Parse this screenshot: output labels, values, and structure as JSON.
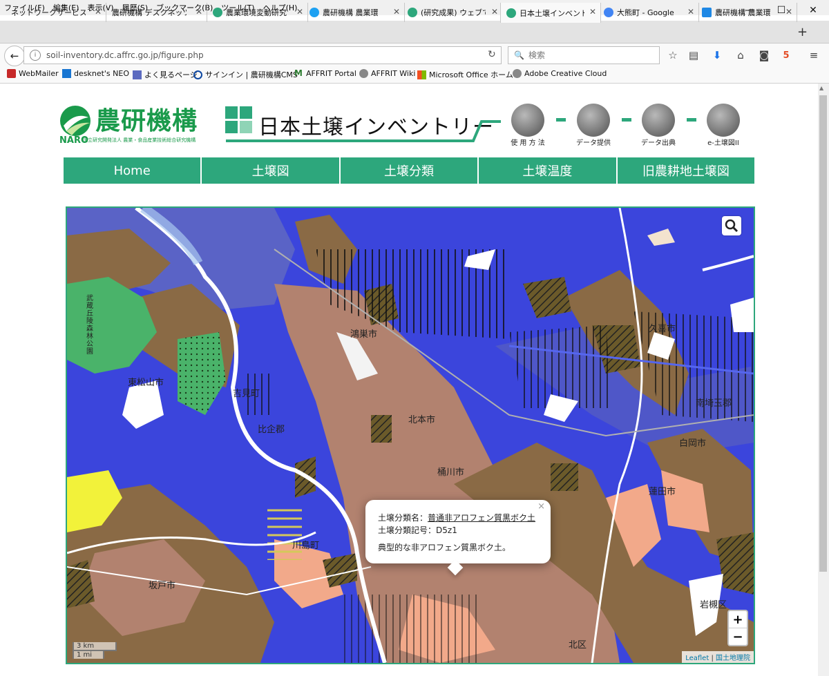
{
  "menubar": {
    "items": [
      "ファイル(F)",
      "編集(E)",
      "表示(V)",
      "履歴(S)",
      "ブックマーク(B)",
      "ツール(T)",
      "ヘルプ(H)"
    ]
  },
  "window_controls": {
    "minimize": "—",
    "maximize": "☐",
    "close": "✕"
  },
  "tabs": [
    {
      "label": "ネットワークサービス",
      "color": "#ffffff"
    },
    {
      "label": "農研機構 デスクネッツ(",
      "color": "#ffffff"
    },
    {
      "label": "農業環境変動研究",
      "color": "#2da77c"
    },
    {
      "label": "農研機構 農業環",
      "color": "#1da1f2"
    },
    {
      "label": "(研究成果) ウェブで",
      "color": "#2da77c"
    },
    {
      "label": "日本土壌インベント",
      "color": "#2da77c"
    },
    {
      "label": "大熊町 - Google",
      "color": "#4285f4"
    },
    {
      "label": "農研機構 農業環",
      "color": "#1e88e5"
    }
  ],
  "active_tab": 5,
  "new_tab_label": "+",
  "navbar": {
    "url": "soil-inventory.dc.affrc.go.jp/figure.php",
    "search_placeholder": "検索",
    "back_icon": "←",
    "reload_icon": "↻",
    "search_icon_glyph": "🔍"
  },
  "bookmarks": [
    {
      "label": "WebMailer",
      "color": "#c62828"
    },
    {
      "label": "desknet's NEO",
      "color": "#1976d2"
    },
    {
      "label": "よく見るページ",
      "color": "#5c6bc0"
    },
    {
      "label": "サインイン | 農研機構CMS",
      "color": "#0d47a1"
    },
    {
      "label": "AFFRIT Portal",
      "color": "#2e7d32"
    },
    {
      "label": "AFFRIT Wiki",
      "color": "#777777"
    },
    {
      "label": "Microsoft Office ホーム",
      "color": "#e64a19"
    },
    {
      "label": "Adobe Creative Cloud",
      "color": "#777777"
    }
  ],
  "header": {
    "org_name": "農研機構",
    "org_abbr": "NARO",
    "org_sub": "国立研究開発法人 農業・食品産業技術総合研究機構",
    "site_title": "日本土壌インベントリー",
    "brand_color": "#2da77c",
    "links": [
      "使 用 方 法",
      "データ提供",
      "データ出典",
      "e-土壌図II"
    ]
  },
  "nav": {
    "items": [
      "Home",
      "土壌図",
      "土壌分類",
      "土壌温度",
      "旧農耕地土壌図"
    ]
  },
  "map": {
    "place_labels": [
      {
        "text": "鴻巣市"
      },
      {
        "text": "東松山市"
      },
      {
        "text": "吉見町"
      },
      {
        "text": "比企郡"
      },
      {
        "text": "北本市"
      },
      {
        "text": "桶川市"
      },
      {
        "text": "川島町"
      },
      {
        "text": "坂戸市"
      },
      {
        "text": "蓮田市"
      },
      {
        "text": "白岡市"
      },
      {
        "text": "南埼玉郡"
      },
      {
        "text": "久喜市"
      },
      {
        "text": "北区"
      },
      {
        "text": "岩槻区"
      },
      {
        "text": "武蔵丘陵森林公園"
      }
    ],
    "popup": {
      "name_label": "土壌分類名：",
      "name_value": "普通非アロフェン質黒ボク土",
      "code_label": "土壌分類記号：",
      "code_value": "D5z1",
      "description": "典型的な非アロフェン質黒ボク土。",
      "close": "×"
    },
    "zoom_in": "+",
    "zoom_out": "−",
    "scale_km": "3 km",
    "scale_mi": "1 mi",
    "attribution_leaflet": "Leaflet",
    "attribution_sep": " | ",
    "attribution_gsi": "国土地理院"
  }
}
